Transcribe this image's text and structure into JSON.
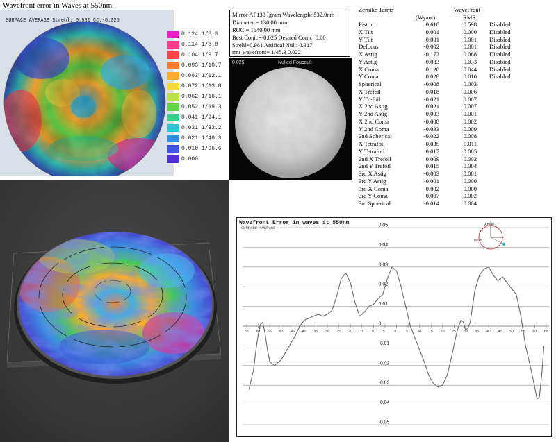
{
  "title_top": "Wavefront error in Waves at 550nm",
  "map2d": {
    "caption": "SURFACE AVERAGE Strehl: 0.981 CC:-0.025",
    "legend": [
      {
        "value": "0.124 1/8.0",
        "color": "#e622c8"
      },
      {
        "value": "0.114 1/8.8",
        "color": "#ff3d8a"
      },
      {
        "value": "0.104 1/9.7",
        "color": "#ff4545"
      },
      {
        "value": "0.093 1/10.7",
        "color": "#ff7a2a"
      },
      {
        "value": "0.083 1/12.1",
        "color": "#ffab2e"
      },
      {
        "value": "0.072 1/13.8",
        "color": "#f3d83a"
      },
      {
        "value": "0.062 1/16.1",
        "color": "#b9e24a"
      },
      {
        "value": "0.052 1/19.3",
        "color": "#63d447"
      },
      {
        "value": "0.041 1/24.1",
        "color": "#2fcf8e"
      },
      {
        "value": "0.031 1/32.2",
        "color": "#2ec4d8"
      },
      {
        "value": "0.021 1/48.3",
        "color": "#2f8fe8"
      },
      {
        "value": "0.010 1/96.6",
        "color": "#3f55e8"
      },
      {
        "value": "0.000",
        "color": "#5030d6"
      }
    ]
  },
  "info": {
    "lines": [
      "Mirror AP130  Igram Wavelength: 532.0nm",
      "Diameter = 130.00 mm",
      "ROC = 1640.00 mm",
      "Best Conic=-0.025 Desired Conic:  0.00",
      " Strehl=0.981  Artifical Null:  0.317",
      "rms wavefront= 1/45.3  0.022"
    ]
  },
  "foucault": {
    "label_left": "0.025",
    "label_center": "Nulled Foucault"
  },
  "zernike": {
    "header_terms": "Zernike Terms",
    "header_wavefront": "WaveFront",
    "header_wyant": "(Wyant)",
    "header_rms": "RMS",
    "rows": [
      {
        "name": "Piston",
        "wyant": "0.618",
        "rms": "0.598",
        "status": "Disabled"
      },
      {
        "name": "X Tilt",
        "wyant": "0.001",
        "rms": "0.000",
        "status": "Disabled"
      },
      {
        "name": "Y Tilt",
        "wyant": "-0.001",
        "rms": "0.001",
        "status": "Disabled"
      },
      {
        "name": "Defocus",
        "wyant": "-0.002",
        "rms": "0.001",
        "status": "Disabled"
      },
      {
        "name": "X Astig",
        "wyant": "-0.172",
        "rms": "0.068",
        "status": "Disabled"
      },
      {
        "name": "Y Astig",
        "wyant": "-0.083",
        "rms": "0.033",
        "status": "Disabled"
      },
      {
        "name": "X Coma",
        "wyant": "0.128",
        "rms": "0.044",
        "status": "Disabled"
      },
      {
        "name": "Y Coma",
        "wyant": "0.028",
        "rms": "0.010",
        "status": "Disabled"
      },
      {
        "name": "Spherical",
        "wyant": "-0.008",
        "rms": "0.003",
        "status": ""
      },
      {
        "name": "X Trefoil",
        "wyant": "-0.018",
        "rms": "0.006",
        "status": ""
      },
      {
        "name": "Y Trefoil",
        "wyant": "-0.021",
        "rms": "0.007",
        "status": ""
      },
      {
        "name": "X 2nd Astig",
        "wyant": "0.021",
        "rms": "0.007",
        "status": ""
      },
      {
        "name": "Y 2nd Astig",
        "wyant": "0.003",
        "rms": "0.001",
        "status": ""
      },
      {
        "name": "X 2nd Coma",
        "wyant": "-0.008",
        "rms": "0.002",
        "status": ""
      },
      {
        "name": "Y 2nd Coma",
        "wyant": "-0.033",
        "rms": "0.009",
        "status": ""
      },
      {
        "name": "2nd Spherical",
        "wyant": "-0.022",
        "rms": "0.008",
        "status": ""
      },
      {
        "name": "X Tetrafoil",
        "wyant": "-0.035",
        "rms": "0.011",
        "status": ""
      },
      {
        "name": "Y Tetrafoil",
        "wyant": "0.017",
        "rms": "0.005",
        "status": ""
      },
      {
        "name": "2nd X Trefoil",
        "wyant": "0.009",
        "rms": "0.002",
        "status": ""
      },
      {
        "name": "2nd Y Trefoil",
        "wyant": "0.015",
        "rms": "0.004",
        "status": ""
      },
      {
        "name": "3rd X Astig",
        "wyant": "-0.003",
        "rms": "0.001",
        "status": ""
      },
      {
        "name": "3rd Y Astig",
        "wyant": "-0.001",
        "rms": "0.000",
        "status": ""
      },
      {
        "name": "3rd X Coma",
        "wyant": "0.002",
        "rms": "0.000",
        "status": ""
      },
      {
        "name": "3rd Y Coma",
        "wyant": "-0.007",
        "rms": "0.002",
        "status": ""
      },
      {
        "name": "3rd Spherical",
        "wyant": "-0.014",
        "rms": "0.004",
        "status": ""
      }
    ]
  },
  "profile": {
    "title": "Wavefront Error in waves at 550nm",
    "subtitle": "SURFACE AVERAGE",
    "angle_label": "Angle",
    "angle_value": "191.5",
    "colors": {
      "line": "#6a6a6a",
      "grid": "#8c8c8c",
      "text": "#222222",
      "dial": "#c23535",
      "dot": "#22b8c8"
    }
  },
  "chart_data": {
    "type": "line",
    "title": "Wavefront Error in waves at 550nm",
    "subtitle": "SURFACE AVERAGE",
    "xlabel": "",
    "ylabel": "",
    "xlim": [
      -65,
      65
    ],
    "ylim": [
      -0.05,
      0.05
    ],
    "x_ticks": [
      -65,
      -60,
      -55,
      -50,
      -45,
      -40,
      -35,
      -30,
      -25,
      -20,
      -15,
      -10,
      -5,
      0,
      5,
      10,
      15,
      20,
      25,
      30,
      35,
      40,
      45,
      50,
      55,
      60,
      65
    ],
    "x_tick_labels": [
      "65",
      "60",
      "55",
      "50",
      "45",
      "40",
      "35",
      "30",
      "25",
      "20",
      "15",
      "10",
      "5",
      "0",
      "5",
      "10",
      "15",
      "20",
      "25",
      "30",
      "35",
      "40",
      "45",
      "50",
      "55",
      "60",
      "65"
    ],
    "y_ticks": [
      0.05,
      0.04,
      0.03,
      0.02,
      0.01,
      0,
      -0.01,
      -0.02,
      -0.03,
      -0.04,
      -0.05
    ],
    "y_tick_labels": [
      "0.05",
      "0.04",
      "0.03",
      "0.02",
      "0.01",
      "0",
      "-0.01",
      "-0.02",
      "-0.03",
      "-0.04",
      "-0.05"
    ],
    "grid": "horizontal",
    "series": [
      {
        "x": [
          -64,
          -62,
          -61,
          -60,
          -59,
          -58,
          -57,
          -56,
          -55,
          -54,
          -53,
          -52,
          -50,
          -48,
          -46,
          -44,
          -42,
          -40,
          -38,
          -36,
          -34,
          -32,
          -30,
          -28,
          -26,
          -24,
          -22,
          -20,
          -18,
          -16,
          -14,
          -12,
          -10,
          -8,
          -6,
          -4,
          -2,
          0,
          2,
          4,
          6,
          8,
          10,
          12,
          14,
          16,
          18,
          20,
          22,
          24,
          26,
          27,
          28,
          29,
          30,
          31,
          32,
          33,
          34,
          36,
          38,
          40,
          42,
          44,
          46,
          48,
          50,
          52,
          54,
          56,
          58,
          60,
          61,
          62,
          63,
          64
        ],
        "y": [
          -0.032,
          -0.022,
          -0.012,
          -0.004,
          0.001,
          0.002,
          -0.004,
          -0.012,
          -0.018,
          -0.019,
          -0.02,
          -0.019,
          -0.017,
          -0.013,
          -0.009,
          -0.005,
          0.0,
          0.003,
          0.004,
          0.005,
          0.006,
          0.005,
          0.006,
          0.008,
          0.015,
          0.024,
          0.027,
          0.022,
          0.012,
          0.005,
          0.007,
          0.01,
          0.011,
          0.014,
          0.016,
          0.024,
          0.03,
          0.028,
          0.02,
          0.01,
          0.0,
          -0.006,
          -0.012,
          -0.018,
          -0.025,
          -0.029,
          -0.031,
          -0.03,
          -0.025,
          -0.015,
          -0.004,
          0.0,
          0.003,
          0.002,
          -0.002,
          -0.001,
          0.002,
          0.01,
          0.018,
          0.026,
          0.029,
          0.03,
          0.026,
          0.023,
          0.025,
          0.022,
          0.019,
          0.016,
          0.005,
          -0.01,
          -0.02,
          -0.031,
          -0.037,
          -0.036,
          -0.025,
          -0.01
        ]
      }
    ]
  }
}
